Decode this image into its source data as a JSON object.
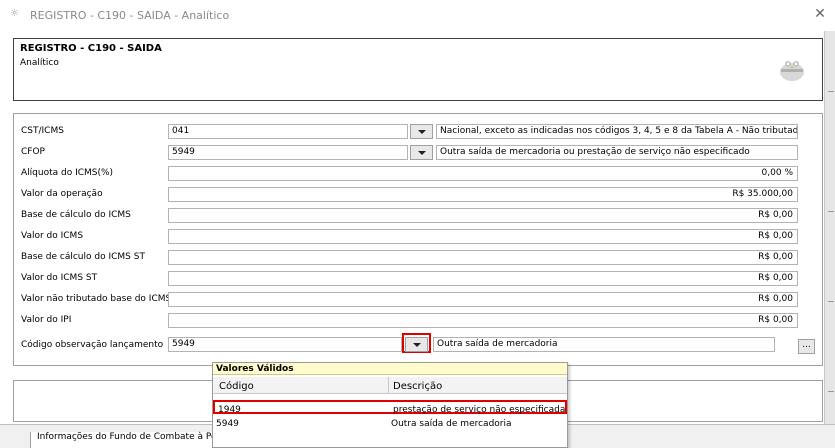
{
  "window": {
    "title": "REGISTRO - C190 - SAIDA - Analítico",
    "close_glyph": "✕",
    "icon": "app-icon"
  },
  "header": {
    "title": "REGISTRO - C190 - SAIDA",
    "subtitle": "Analítico",
    "logo_icon": "owl-logo-icon"
  },
  "form": {
    "cst_icms": {
      "label": "CST/ICMS",
      "code": "041",
      "description": "Nacional, exceto as indicadas nos códigos 3, 4, 5 e 8 da Tabela A - Não tributada"
    },
    "cfop": {
      "label": "CFOP",
      "code": "5949",
      "description": "Outra saída de mercadoria ou prestação de serviço não especificado"
    },
    "aliquota": {
      "label": "Alíquota do ICMS(%)",
      "value": "0,00 %"
    },
    "valor_operacao": {
      "label": "Valor da operação",
      "value": "R$ 35.000,00"
    },
    "base_icms": {
      "label": "Base de cálculo do ICMS",
      "value": "R$ 0,00"
    },
    "valor_icms": {
      "label": "Valor do ICMS",
      "value": "R$ 0,00"
    },
    "base_icms_st": {
      "label": "Base de cálculo do ICMS ST",
      "value": "R$ 0,00"
    },
    "valor_icms_st": {
      "label": "Valor do ICMS ST",
      "value": "R$ 0,00"
    },
    "valor_nao_tributado": {
      "label": "Valor não tributado base do ICMS",
      "value": "R$ 0,00"
    },
    "valor_ipi": {
      "label": "Valor do IPI",
      "value": "R$ 0,00"
    },
    "codigo_obs": {
      "label": "Código observação lançamento",
      "code": "5949",
      "description": "Outra saída de mercadoria",
      "ellipsis": "..."
    }
  },
  "bottom": {
    "item_label": "Informações do Fundo de Combate à Pob"
  },
  "popup": {
    "title": "Valores Válidos",
    "col_code": "Código",
    "col_desc": "Descrição",
    "rows": [
      {
        "code": "1949",
        "description": "prestação de serviço não especificada"
      },
      {
        "code": "5949",
        "description": "Outra saída de mercadoria"
      }
    ]
  },
  "colors": {
    "highlight": "#e00000",
    "popup_title_bg": "#fffbcc"
  }
}
